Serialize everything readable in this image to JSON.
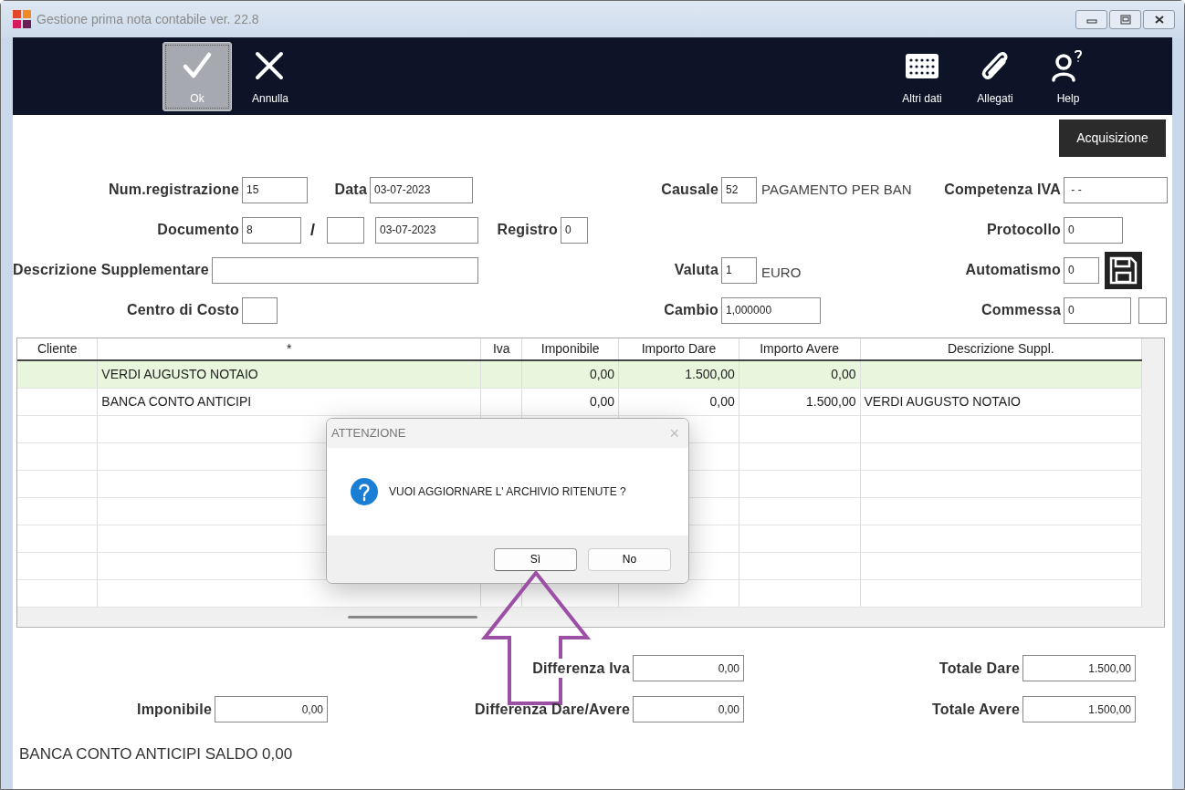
{
  "window": {
    "title": "Gestione prima nota contabile ver. 22.8"
  },
  "toolbar": {
    "left": [
      {
        "label": "Ok",
        "selected": true
      },
      {
        "label": "Annulla",
        "selected": false
      }
    ],
    "right": [
      {
        "label": "Altri dati",
        "selected": false
      },
      {
        "label": "Allegati",
        "selected": false
      },
      {
        "label": "Help",
        "selected": false
      }
    ]
  },
  "acquisizione_button": "Acquisizione",
  "header": {
    "num_registrazione": {
      "label": "Num.registrazione",
      "value": "15"
    },
    "data": {
      "label": "Data",
      "value": "03-07-2023"
    },
    "causale": {
      "label": "Causale",
      "value": "52",
      "description": "PAGAMENTO PER BAN"
    },
    "competenza_iva": {
      "label": "Competenza IVA",
      "value": " - -"
    },
    "documento": {
      "label": "Documento",
      "value": "8",
      "separator": "/",
      "date": "03-07-2023"
    },
    "registro": {
      "label": "Registro",
      "value": "0"
    },
    "protocollo": {
      "label": "Protocollo",
      "value": "0"
    },
    "descrizione": {
      "label": "Descrizione Supplementare"
    },
    "valuta": {
      "label": "Valuta",
      "value": "1",
      "description": "EURO"
    },
    "automatismo": {
      "label": "Automatismo",
      "value": "0"
    },
    "centro_costo": {
      "label": "Centro di Costo"
    },
    "cambio": {
      "label": "Cambio",
      "value": "1,000000"
    },
    "commessa": {
      "label": "Commessa",
      "value": "0"
    }
  },
  "table": {
    "columns": [
      "Cliente",
      "*",
      "Iva",
      "Imponibile",
      "Importo Dare",
      "Importo Avere",
      "Descrizione Suppl."
    ],
    "rows": [
      {
        "cells": [
          "",
          "VERDI AUGUSTO NOTAIO",
          "",
          "0,00",
          "1.500,00",
          "0,00",
          ""
        ],
        "selected": true
      },
      {
        "cells": [
          "",
          "BANCA CONTO ANTICIPI",
          "",
          "0,00",
          "0,00",
          "1.500,00",
          "VERDI AUGUSTO NOTAIO"
        ],
        "selected": false
      }
    ]
  },
  "totals": {
    "differenza_iva": {
      "label": "Differenza Iva",
      "value": "0,00"
    },
    "totale_dare": {
      "label": "Totale Dare",
      "value": "1.500,00"
    },
    "imponibile": {
      "label": "Imponibile",
      "value": "0,00"
    },
    "differenza_dare_avere": {
      "label": "Differenza Dare/Avere",
      "value": "0,00"
    },
    "totale_avere": {
      "label": "Totale Avere",
      "value": "1.500,00"
    }
  },
  "status_text": "BANCA CONTO ANTICIPI SALDO 0,00",
  "dialog": {
    "title": "ATTENZIONE",
    "close": "×",
    "message": "VUOI AGGIORNARE L' ARCHIVIO RITENUTE ?",
    "buttons": [
      {
        "label": "Sì",
        "selected": true
      },
      {
        "label": "No",
        "selected": false
      }
    ]
  }
}
